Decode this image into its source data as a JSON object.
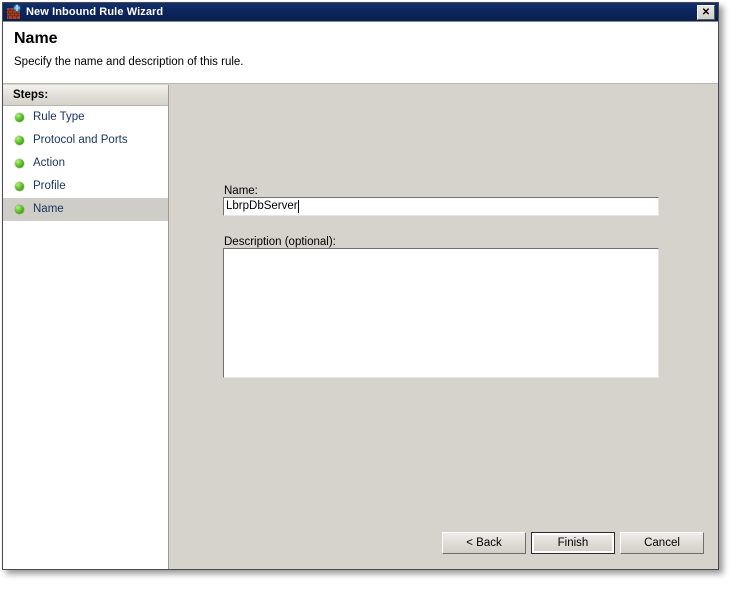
{
  "window": {
    "title": "New Inbound Rule Wizard",
    "icon": "firewall-brick-globe-icon",
    "close_label": "✕",
    "title_bar_color": "#0b2359"
  },
  "header": {
    "title": "Name",
    "subtitle": "Specify the name and description of this rule."
  },
  "sidebar": {
    "header": "Steps:",
    "items": [
      {
        "label": "Rule Type",
        "selected": false,
        "bullet": "green-ball-icon"
      },
      {
        "label": "Protocol and Ports",
        "selected": false,
        "bullet": "green-ball-icon"
      },
      {
        "label": "Action",
        "selected": false,
        "bullet": "green-ball-icon"
      },
      {
        "label": "Profile",
        "selected": false,
        "bullet": "green-ball-icon"
      },
      {
        "label": "Name",
        "selected": true,
        "bullet": "green-ball-icon"
      }
    ]
  },
  "form": {
    "name_label": "Name:",
    "name_value": "LbrpDbServer",
    "name_placeholder": "",
    "description_label": "Description (optional):",
    "description_value": "",
    "description_placeholder": ""
  },
  "buttons": {
    "back": "< Back",
    "finish": "Finish",
    "cancel": "Cancel"
  },
  "colors": {
    "pane_background": "#d6d3cd",
    "selection": "#cfcdc7",
    "link_text": "#17335e",
    "bullet_green": "#5ec22a"
  }
}
